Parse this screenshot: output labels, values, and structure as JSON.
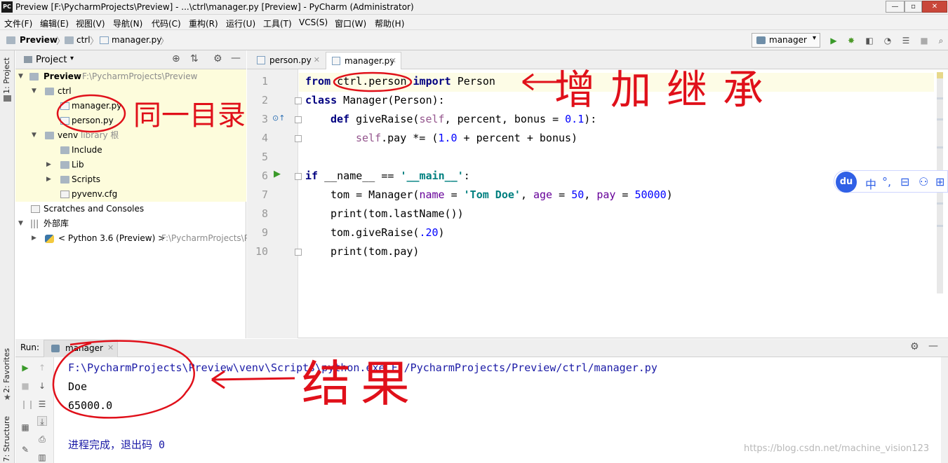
{
  "window": {
    "title": "Preview [F:\\PycharmProjects\\Preview] - ...\\ctrl\\manager.py [Preview] - PyCharm (Administrator)",
    "app_badge": "PC",
    "minimize": "—",
    "maximize": "▫",
    "close": "✕"
  },
  "menu": [
    "文件(F)",
    "编辑(E)",
    "视图(V)",
    "导航(N)",
    "代码(C)",
    "重构(R)",
    "运行(U)",
    "工具(T)",
    "VCS(S)",
    "窗口(W)",
    "帮助(H)"
  ],
  "breadcrumb": {
    "project": "Preview",
    "folder": "ctrl",
    "file": "manager.py"
  },
  "toolbar": {
    "run_config": "manager"
  },
  "side_tabs": {
    "project": "1: Project",
    "favorites": "2: Favorites",
    "structure": "7: Structure"
  },
  "project_panel": {
    "header": "Project",
    "tree": [
      {
        "label": "Preview",
        "hint": "F:\\PycharmProjects\\Preview",
        "bold": true
      },
      {
        "label": "ctrl",
        "hint": ""
      },
      {
        "label": "manager.py",
        "hint": ""
      },
      {
        "label": "person.py",
        "hint": ""
      },
      {
        "label": "venv",
        "hint": "library 根"
      },
      {
        "label": "Include",
        "hint": ""
      },
      {
        "label": "Lib",
        "hint": ""
      },
      {
        "label": "Scripts",
        "hint": ""
      },
      {
        "label": "pyvenv.cfg",
        "hint": ""
      },
      {
        "label": "Scratches and Consoles",
        "hint": ""
      },
      {
        "label": "外部库",
        "hint": ""
      },
      {
        "label": "< Python 3.6 (Preview) >",
        "hint": "F:\\PycharmProjects\\P"
      }
    ]
  },
  "editor": {
    "tabs": [
      {
        "label": "person.py",
        "active": false
      },
      {
        "label": "manager.py",
        "active": true
      }
    ],
    "line_numbers": [
      "1",
      "2",
      "3",
      "4",
      "5",
      "6",
      "7",
      "8",
      "9",
      "10"
    ],
    "code": {
      "l1_kw1": "from",
      "l1_mod": " ctrl.person ",
      "l1_kw2": "import",
      "l1_name": " Person",
      "l2_kw": "class",
      "l2_name": " Manager(",
      "l2_base": "Person",
      "l2_end": "):",
      "l3_kw": "def",
      "l3_a": " giveRaise(",
      "l3_self": "self",
      "l3_b": ", percent, bonus = ",
      "l3_num": "0.1",
      "l3_c": "):",
      "l4_self": "self",
      "l4_a": ".pay *= (",
      "l4_num": "1.0",
      "l4_b": " + percent + bonus)",
      "l6_kw": "if",
      "l6_a": " __name__ == ",
      "l6_str": "'__main__'",
      "l6_b": ":",
      "l7_a": "tom = Manager(",
      "l7_p1": "name",
      "l7_b": " = ",
      "l7_s": "'Tom Doe'",
      "l7_c": ", ",
      "l7_p2": "age",
      "l7_d": " = ",
      "l7_n1": "50",
      "l7_e": ", ",
      "l7_p3": "pay",
      "l7_f": " = ",
      "l7_n2": "50000",
      "l7_g": ")",
      "l8": "print(tom.lastName())",
      "l9_a": "tom.giveRaise(",
      "l9_n": ".20",
      "l9_b": ")",
      "l10": "print(tom.pay)"
    }
  },
  "run_panel": {
    "label": "Run:",
    "tab": "manager",
    "output": [
      "F:\\PycharmProjects\\Preview\\venv\\Scripts\\python.exe F:/PycharmProjects/Preview/ctrl/manager.py",
      "Doe",
      "65000.0",
      "",
      "进程完成，退出码 0"
    ]
  },
  "ime_toolbar": {
    "logo": "du",
    "items": [
      "中",
      "°,",
      "⊟",
      "⚇",
      "⊞"
    ]
  },
  "annotations": {
    "same_dir": "同一目录",
    "add_inherit": "增加继承",
    "result": "结果"
  },
  "watermark": "https://blog.csdn.net/machine_vision123",
  "colors": {
    "keyword": "#000080",
    "string": "#008080",
    "number": "#0000ff",
    "self": "#94558d",
    "annotation_red": "#e0101a"
  }
}
